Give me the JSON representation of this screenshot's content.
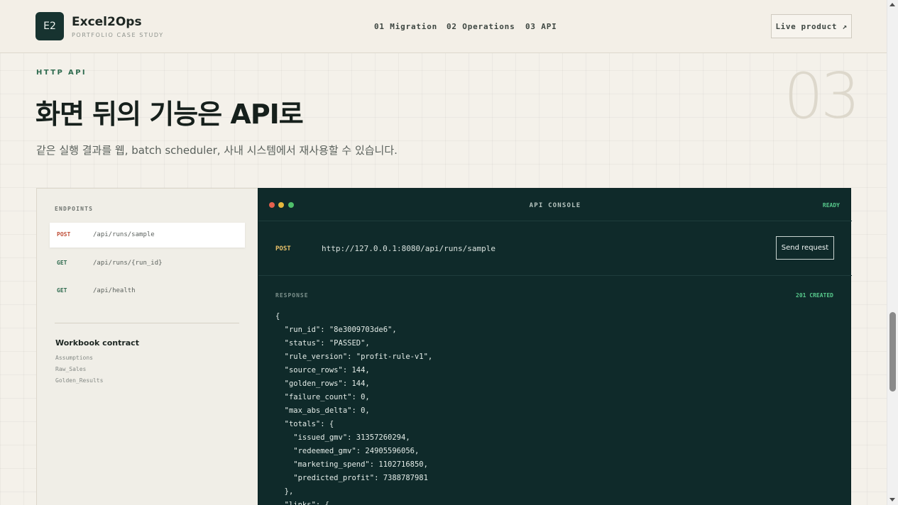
{
  "header": {
    "logo_text": "E2",
    "brand_name": "Excel2Ops",
    "brand_sub": "PORTFOLIO CASE STUDY",
    "nav": [
      "01 Migration",
      "02 Operations",
      "03 API"
    ],
    "live_label": "Live product ↗"
  },
  "section": {
    "eyebrow": "HTTP API",
    "title": "화면 뒤의 기능은 API로",
    "number": "03",
    "subtitle": "같은 실행 결과를 웹, batch scheduler, 사내 시스템에서 재사용할 수 있습니다."
  },
  "endpoints": {
    "title": "ENDPOINTS",
    "items": [
      {
        "method": "POST",
        "path": "/api/runs/sample"
      },
      {
        "method": "GET",
        "path": "/api/runs/{run_id}"
      },
      {
        "method": "GET",
        "path": "/api/health"
      }
    ],
    "workbook_title": "Workbook contract",
    "workbook_items": [
      "Assumptions",
      "Raw_Sales",
      "Golden_Results"
    ]
  },
  "console": {
    "title": "API CONSOLE",
    "ready": "READY",
    "method": "POST",
    "url": "http://127.0.0.1:8080/api/runs/sample",
    "send_label": "Send request",
    "response_label": "RESPONSE",
    "response_status": "201 CREATED",
    "code_lines": [
      "{",
      "  \"run_id\": \"8e3009703de6\",",
      "  \"status\": \"PASSED\",",
      "  \"rule_version\": \"profit-rule-v1\",",
      "  \"source_rows\": 144,",
      "  \"golden_rows\": 144,",
      "  \"failure_count\": 0,",
      "  \"max_abs_delta\": 0,",
      "  \"totals\": {",
      "    \"issued_gmv\": 31357260294,",
      "    \"redeemed_gmv\": 24905596056,",
      "    \"marketing_spend\": 1102716850,",
      "    \"predicted_profit\": 7388787981",
      "  },",
      "  \"links\": {"
    ]
  },
  "colors": {
    "accent": "#2f6b4f",
    "console_bg": "#0f2a2a",
    "post": "#c0503a",
    "get": "#2f6b4f",
    "ok": "#57c98c"
  }
}
